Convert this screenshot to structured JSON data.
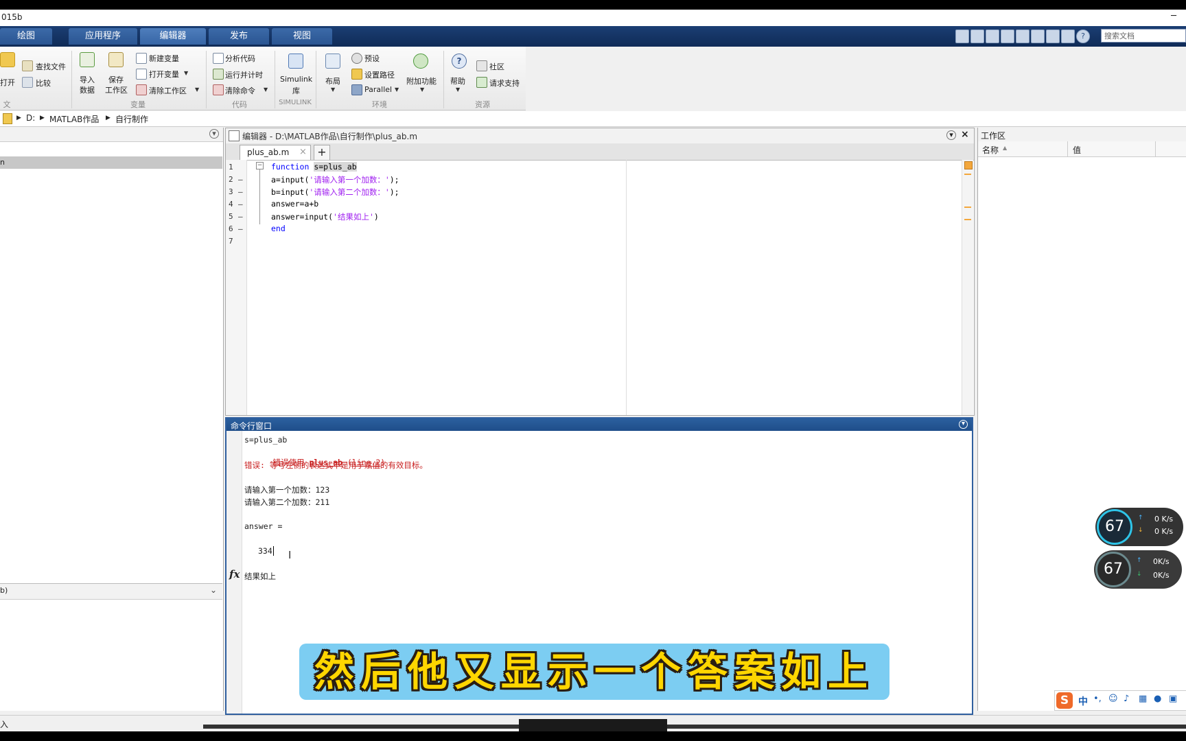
{
  "window": {
    "title": "015b"
  },
  "tabs": [
    "绘图",
    "应用程序",
    "编辑器",
    "发布",
    "视图"
  ],
  "search_docs": {
    "placeholder": "搜索文档"
  },
  "ribbon": {
    "file": {
      "open": "打开",
      "find_files": "查找文件",
      "compare": "比较",
      "group": "文件"
    },
    "variable": {
      "import_data": [
        "导入",
        "数据"
      ],
      "save_workspace": [
        "保存",
        "工作区"
      ],
      "new_variable": "新建变量",
      "open_variable": "打开变量",
      "clear_workspace": "清除工作区",
      "group": "变量"
    },
    "code": {
      "analyze_code": "分析代码",
      "run_and_time": "运行并计时",
      "clear_commands": "清除命令",
      "group": "代码"
    },
    "simulink": {
      "label": [
        "Simulink",
        "库"
      ],
      "group": "SIMULINK"
    },
    "environment": {
      "layout": "布局",
      "preferences": "预设",
      "set_path": "设置路径",
      "parallel": "Parallel",
      "add_ons": "附加功能",
      "group": "环境"
    },
    "resources": {
      "help": "帮助",
      "community": "社区",
      "request_support": "请求支持",
      "group": "资源"
    }
  },
  "breadcrumb": [
    "D:",
    "MATLAB作品",
    "自行制作"
  ],
  "left_panel": {
    "selected_item": "n",
    "lower_header": "b)"
  },
  "editor": {
    "title": "编辑器 - D:\\MATLAB作品\\自行制作\\plus_ab.m",
    "file_tab": "plus_ab.m",
    "lines": [
      {
        "num": "1",
        "parts": [
          {
            "t": "function ",
            "c": "kw"
          },
          {
            "t": "s=plus_ab",
            "c": "hl"
          }
        ]
      },
      {
        "num": "2",
        "parts": [
          {
            "t": "a=input(",
            "c": ""
          },
          {
            "t": "'请输入第一个加数：'",
            "c": "str"
          },
          {
            "t": ");",
            "c": ""
          }
        ]
      },
      {
        "num": "3",
        "parts": [
          {
            "t": "b=input(",
            "c": ""
          },
          {
            "t": "'请输入第二个加数：'",
            "c": "str"
          },
          {
            "t": ");",
            "c": ""
          }
        ]
      },
      {
        "num": "4",
        "parts": [
          {
            "t": "answer=a+b",
            "c": ""
          }
        ]
      },
      {
        "num": "5",
        "parts": [
          {
            "t": "answer=input(",
            "c": ""
          },
          {
            "t": "'结果如上'",
            "c": "str"
          },
          {
            "t": ")",
            "c": ""
          }
        ]
      },
      {
        "num": "6",
        "parts": [
          {
            "t": "end",
            "c": "kw"
          }
        ]
      },
      {
        "num": "7",
        "parts": []
      }
    ]
  },
  "command_window": {
    "title": "命令行窗口",
    "l1": "s=plus_ab",
    "err_prefix": "错误使用 ",
    "err_func": "plus_ab",
    "err_line": "line 2",
    "err_msg": "错误: 等号左侧的表达式不是用于赋值的有效目标。",
    "prompt1": "请输入第一个加数：123",
    "prompt2": "请输入第二个加数：211",
    "answer_label": "answer =",
    "answer_value": "334",
    "fx_prompt": "结果如上"
  },
  "workspace": {
    "title": "工作区",
    "col_name": "名称",
    "col_value": "值"
  },
  "status": {
    "text": "入"
  },
  "caption": "然后他又显示一个答案如上",
  "meters": [
    {
      "percent": "67",
      "up": "0 K/s",
      "down": "0 K/s"
    },
    {
      "percent": "67",
      "up": "0K/s",
      "down": "0K/s"
    }
  ],
  "ime": {
    "lang": "中"
  }
}
